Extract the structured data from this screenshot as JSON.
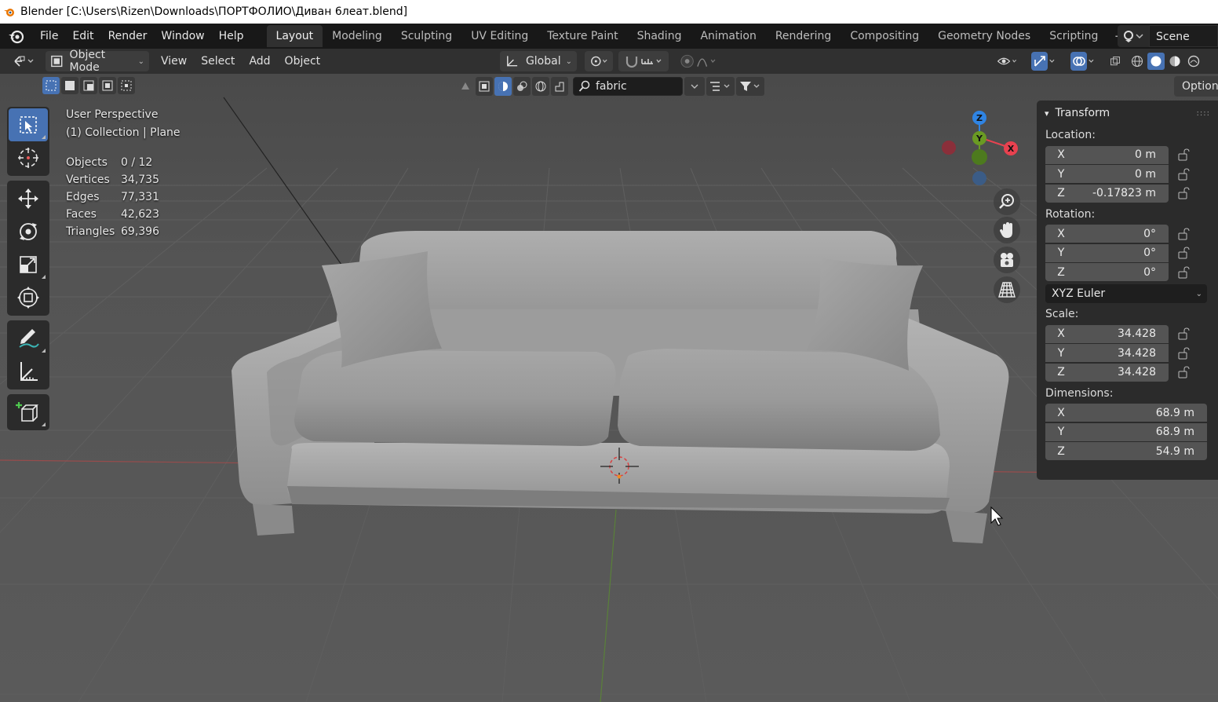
{
  "window": {
    "title": "Blender [C:\\Users\\Rizen\\Downloads\\ПОРТФОЛИО\\Диван 6леат.blend]"
  },
  "menu": [
    "File",
    "Edit",
    "Render",
    "Window",
    "Help"
  ],
  "workspaces": [
    "Layout",
    "Modeling",
    "Sculpting",
    "UV Editing",
    "Texture Paint",
    "Shading",
    "Animation",
    "Rendering",
    "Compositing",
    "Geometry Nodes",
    "Scripting"
  ],
  "active_workspace": "Layout",
  "scene": {
    "name": "Scene"
  },
  "header": {
    "mode": "Object Mode",
    "menus": [
      "View",
      "Select",
      "Add",
      "Object"
    ],
    "orientation": "Global"
  },
  "filter": {
    "search_value": "fabric"
  },
  "options_label": "Options",
  "overlay": {
    "view_name": "User Perspective",
    "collection": "(1) Collection | Plane",
    "stats": [
      {
        "label": "Objects",
        "value": "0 / 12"
      },
      {
        "label": "Vertices",
        "value": "34,735"
      },
      {
        "label": "Edges",
        "value": "77,331"
      },
      {
        "label": "Faces",
        "value": "42,623"
      },
      {
        "label": "Triangles",
        "value": "69,396"
      }
    ]
  },
  "gizmo": {
    "x_label": "X",
    "y_label": "Y",
    "z_label": "Z"
  },
  "transform": {
    "title": "Transform",
    "location_label": "Location:",
    "location": [
      {
        "axis": "X",
        "value": "0 m"
      },
      {
        "axis": "Y",
        "value": "0 m"
      },
      {
        "axis": "Z",
        "value": "-0.17823 m"
      }
    ],
    "rotation_label": "Rotation:",
    "rotation": [
      {
        "axis": "X",
        "value": "0°"
      },
      {
        "axis": "Y",
        "value": "0°"
      },
      {
        "axis": "Z",
        "value": "0°"
      }
    ],
    "rotation_mode": "XYZ Euler",
    "scale_label": "Scale:",
    "scale": [
      {
        "axis": "X",
        "value": "34.428"
      },
      {
        "axis": "Y",
        "value": "34.428"
      },
      {
        "axis": "Z",
        "value": "34.428"
      }
    ],
    "dimensions_label": "Dimensions:",
    "dimensions": [
      {
        "axis": "X",
        "value": "68.9 m"
      },
      {
        "axis": "Y",
        "value": "68.9 m"
      },
      {
        "axis": "Z",
        "value": "54.9 m"
      }
    ]
  },
  "colors": {
    "accent": "#4772b3",
    "axis_x": "#e8414f",
    "axis_y": "#6a9a23",
    "axis_z": "#2f84e3"
  }
}
